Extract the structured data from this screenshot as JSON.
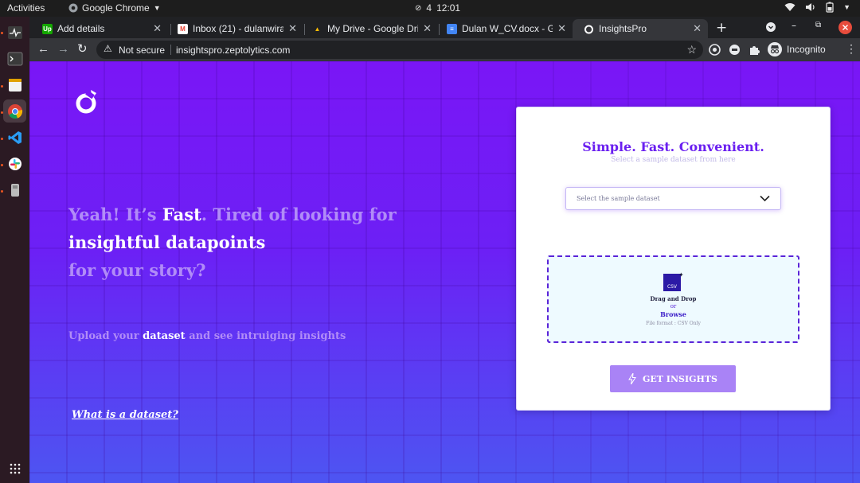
{
  "os": {
    "activities": "Activities",
    "app_name": "Google Chrome",
    "clock_day": "4",
    "clock_time": "12:01"
  },
  "tabs": [
    {
      "title": "Add details",
      "favicon": "upwork-icon",
      "favicon_text": "Up",
      "color": "#14a800"
    },
    {
      "title": "Inbox (21) - dulanwira",
      "favicon": "gmail-icon",
      "favicon_text": "M",
      "color": "#ea4335"
    },
    {
      "title": "My Drive - Google Driv",
      "favicon": "drive-icon",
      "favicon_text": "▲",
      "color": "#fbbc04"
    },
    {
      "title": "Dulan W_CV.docx - Go",
      "favicon": "docs-icon",
      "favicon_text": "≡",
      "color": "#4285f4"
    },
    {
      "title": "InsightsPro",
      "favicon": "insightspro-icon",
      "favicon_text": "",
      "color": "#ffffff",
      "active": true
    }
  ],
  "toolbar": {
    "security_label": "Not secure",
    "url": "insightspro.zeptolytics.com",
    "profile_label": "Incognito"
  },
  "page": {
    "hero": {
      "part1": "Yeah! It’s ",
      "fast": "Fast",
      "part2": ". Tired of looking for",
      "insightful": "insightful datapoints",
      "story": "for your story?"
    },
    "upload": {
      "part1": "Upload your ",
      "dataset": "dataset",
      "part2": " and see intruiging insights"
    },
    "dataset_link": "What is a dataset?",
    "card": {
      "title": "Simple. Fast. Convenient.",
      "subtitle": "Select a sample dataset from here",
      "select_placeholder": "Select the sample dataset",
      "csv_badge": "CSV",
      "drag_drop": "Drag and Drop",
      "or": "or",
      "browse": "Browse",
      "file_format": "File format : CSV Only",
      "button": "GET INSIGHTS"
    }
  },
  "colors": {
    "brand": "#6a1ff0",
    "button": "#a983f6",
    "bg_top": "#7a16f6",
    "bg_bottom": "#4d55f2"
  }
}
